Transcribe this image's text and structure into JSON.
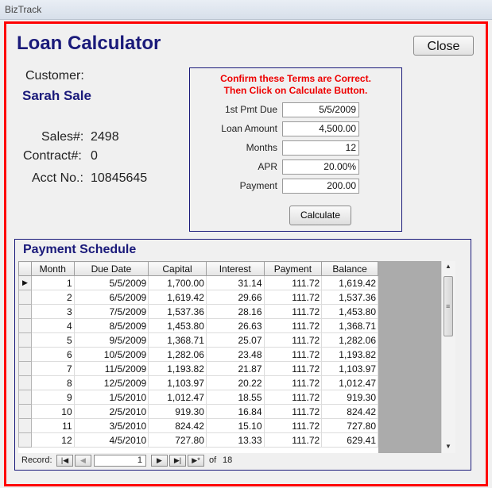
{
  "window": {
    "title": "BizTrack"
  },
  "form": {
    "title": "Loan Calculator",
    "close_label": "Close",
    "customer_label": "Customer:",
    "customer_name": "Sarah Sale",
    "sales_label": "Sales#:",
    "sales_value": "2498",
    "contract_label": "Contract#:",
    "contract_value": "0",
    "acct_label": "Acct No.:",
    "acct_value": "10845645"
  },
  "terms": {
    "message_line1": "Confirm these Terms are Correct.",
    "message_line2": "Then Click on Calculate Button.",
    "fields": [
      {
        "label": "1st Pmt Due",
        "value": "5/5/2009"
      },
      {
        "label": "Loan Amount",
        "value": "4,500.00"
      },
      {
        "label": "Months",
        "value": "12"
      },
      {
        "label": "APR",
        "value": "20.00%"
      },
      {
        "label": "Payment",
        "value": "200.00"
      }
    ],
    "calculate_label": "Calculate"
  },
  "schedule": {
    "title": "Payment Schedule",
    "columns": [
      "Month",
      "Due Date",
      "Capital",
      "Interest",
      "Payment",
      "Balance"
    ],
    "rows": [
      [
        "1",
        "5/5/2009",
        "1,700.00",
        "31.14",
        "111.72",
        "1,619.42"
      ],
      [
        "2",
        "6/5/2009",
        "1,619.42",
        "29.66",
        "111.72",
        "1,537.36"
      ],
      [
        "3",
        "7/5/2009",
        "1,537.36",
        "28.16",
        "111.72",
        "1,453.80"
      ],
      [
        "4",
        "8/5/2009",
        "1,453.80",
        "26.63",
        "111.72",
        "1,368.71"
      ],
      [
        "5",
        "9/5/2009",
        "1,368.71",
        "25.07",
        "111.72",
        "1,282.06"
      ],
      [
        "6",
        "10/5/2009",
        "1,282.06",
        "23.48",
        "111.72",
        "1,193.82"
      ],
      [
        "7",
        "11/5/2009",
        "1,193.82",
        "21.87",
        "111.72",
        "1,103.97"
      ],
      [
        "8",
        "12/5/2009",
        "1,103.97",
        "20.22",
        "111.72",
        "1,012.47"
      ],
      [
        "9",
        "1/5/2010",
        "1,012.47",
        "18.55",
        "111.72",
        "919.30"
      ],
      [
        "10",
        "2/5/2010",
        "919.30",
        "16.84",
        "111.72",
        "824.42"
      ],
      [
        "11",
        "3/5/2010",
        "824.42",
        "15.10",
        "111.72",
        "727.80"
      ],
      [
        "12",
        "4/5/2010",
        "727.80",
        "13.33",
        "111.72",
        "629.41"
      ]
    ],
    "navigator": {
      "record_label": "Record:",
      "current": "1",
      "of_label": "of",
      "total": "18"
    }
  }
}
